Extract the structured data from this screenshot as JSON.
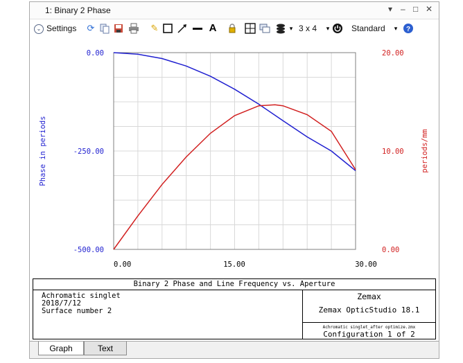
{
  "window": {
    "title": "1: Binary 2 Phase",
    "controls": [
      "▾",
      "‒",
      "□",
      "✕"
    ]
  },
  "toolbar": {
    "settings_label": "Settings",
    "layout_label": "3 x 4",
    "standard_label": "Standard",
    "icons": [
      "refresh-icon",
      "copy-icon",
      "save-icon",
      "print-icon",
      "pencil-icon",
      "rectangle-icon",
      "arrow-icon",
      "line-icon",
      "text-icon",
      "lock-icon",
      "window-layout-icon",
      "clone-icon",
      "layers-icon",
      "power-icon",
      "help-icon"
    ],
    "colors": {
      "refresh": "#2f6fd6",
      "pencil": "#d9a400",
      "help": "#2c5fd0"
    }
  },
  "chart_data": {
    "type": "line",
    "title": "Binary 2 Phase and Line Frequency vs. Aperture",
    "xlabel": "",
    "ylabel": "Phase in periods",
    "y2label": "periods/mm",
    "xlim": [
      0,
      30
    ],
    "ylim": [
      -500,
      0
    ],
    "y2lim": [
      0,
      20
    ],
    "x_ticks": [
      "0.00",
      "15.00",
      "30.00"
    ],
    "y_ticks": [
      "0.00",
      "-250.00",
      "-500.00"
    ],
    "y2_ticks": [
      "20.00",
      "10.00",
      "0.00"
    ],
    "grid": true,
    "series": [
      {
        "axis": "left",
        "color": "#1f1fd0",
        "x": [
          0,
          3,
          6,
          9,
          12,
          15,
          18,
          21,
          24,
          27,
          30
        ],
        "y": [
          0,
          -4,
          -15,
          -34,
          -60,
          -93,
          -131,
          -173,
          -214,
          -250,
          -300
        ]
      },
      {
        "axis": "right",
        "color": "#d11f1f",
        "x": [
          0,
          3,
          6,
          9,
          12,
          15,
          18,
          20,
          21,
          24,
          27,
          30
        ],
        "y": [
          0,
          3.4,
          6.6,
          9.4,
          11.8,
          13.6,
          14.6,
          14.7,
          14.6,
          13.7,
          12.0,
          8.1
        ]
      }
    ],
    "colors": {
      "left_axis": "#1f1fd0",
      "right_axis": "#d11f1f",
      "grid": "#d8d8d8"
    }
  },
  "footer": {
    "title": "Binary 2 Phase and Line Frequency vs. Aperture",
    "left_lines": [
      "Achromatic singlet",
      "2018/7/12",
      "Surface number 2"
    ],
    "brand": "Zemax",
    "product": "Zemax OpticStudio 18.1",
    "file": "Achromatic singlet_after optimize.zmx",
    "config": "Configuration 1 of 2"
  },
  "tabs": [
    {
      "label": "Graph",
      "active": true
    },
    {
      "label": "Text",
      "active": false
    }
  ]
}
